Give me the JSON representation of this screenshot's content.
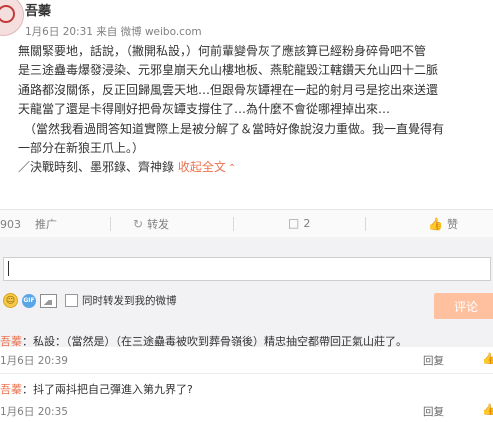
{
  "post": {
    "author": "吾蓁",
    "meta": "1月6日 20:31 来自 微博 weibo.com",
    "lines": [
      "無關緊要地，話說，（撇開私設，）何前輩變骨灰了應該算已經粉身碎骨吧不管",
      "是三途蠱毒爆發浸染、元邪皇崩天允山樓地板、燕駝龍毀江轄鑽天允山四十二脈",
      "通路都沒關係，反正回歸風雲天地…但跟骨灰罈裡在一起的射月弓是挖出來送還",
      "天龍當了還是卡得剛好把骨灰罈支撐住了…為什麼不會從哪裡掉出來…",
      "（當然我看過問答知道實際上是被分解了＆當時好像說沒力重做。我一直覺得有",
      "一部分在新狼王爪上。）"
    ],
    "tags_line": "／決戰時刻、墨邪錄、齊神錄",
    "collapse_label": "收起全文",
    "collapse_icon": "chevron-up-icon"
  },
  "actions": {
    "promote_count": "903",
    "promote_label": "推广",
    "repost_label": "转发",
    "comment_count": "2",
    "like_label": "赞"
  },
  "compose": {
    "input_value": "",
    "also_repost_label": "同时转发到我的微博",
    "submit_label": "评论"
  },
  "comments": [
    {
      "name": "吾蓁",
      "text": "：私設：（當然是）（在三途蠱毒被吹到葬骨嶺後）精忠抽空都帶回正氣山莊了。",
      "time": "1月6日 20:39",
      "reply_label": "回复",
      "like_label": "赞"
    },
    {
      "name": "吾蓁",
      "text": "：抖了兩抖把自己彈進入第九界了?",
      "time": "1月6日 20:35",
      "reply_label": "回复",
      "like_label": "赞"
    }
  ],
  "colors": {
    "accent": "#eb7350",
    "submit_disabled": "#ffc09f",
    "compose_bg": "#f2f2f5"
  }
}
